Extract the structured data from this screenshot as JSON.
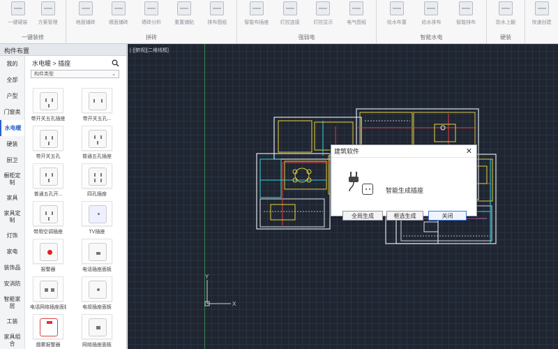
{
  "ribbon": {
    "groups": [
      {
        "label": "一键装修",
        "buttons": [
          "一键硬装",
          "方案管理"
        ]
      },
      {
        "label": "拼砖",
        "buttons": [
          "地面铺砖",
          "墙面铺砖",
          "墙砖分析",
          "重置铺贴",
          "排布图纸"
        ]
      },
      {
        "label": "强弱电",
        "buttons": [
          "智能布插座",
          "灯控连接",
          "灯控显示",
          "电气图纸"
        ]
      },
      {
        "label": "智能水电",
        "buttons": [
          "给水布置",
          "给水排布",
          "智能排布"
        ]
      },
      {
        "label": "硬装",
        "buttons": [
          "防水上翻"
        ]
      },
      {
        "label": "",
        "buttons": [
          "快速创建"
        ]
      }
    ]
  },
  "panel": {
    "title": "构件布置",
    "categories": [
      "我的",
      "全部",
      "户型",
      "门窗类",
      "水电暖",
      "硬装",
      "厨卫",
      "橱柜定制",
      "家具",
      "家具定制",
      "灯饰",
      "家电",
      "装饰品",
      "安消防",
      "智能家居",
      "工装",
      "家具组合"
    ],
    "active_category": "水电暖",
    "breadcrumb": "水电暖 > 插座",
    "filter": "构件类型",
    "filter_arrow": "⌄",
    "search_icon": "search-icon",
    "items": [
      "带开关五孔插座",
      "带开关五孔...",
      "带开关五孔",
      "普通五孔插座",
      "普通五孔开...",
      "四孔插座",
      "带用空调插座",
      "TV插座",
      "报警器",
      "电话插座面板",
      "电话网络插座面板",
      "电视插座面板",
      "烟雾报警器",
      "网络插座面板"
    ]
  },
  "canvas": {
    "view_tag": "[-][俯视][二维线框]",
    "axis_x": "X",
    "axis_y": "Y"
  },
  "dialog": {
    "title": "建筑软件",
    "close_glyph": "✕",
    "message": "智能生成插座",
    "buttons": [
      "全局生成",
      "框选生成",
      "关闭"
    ]
  }
}
